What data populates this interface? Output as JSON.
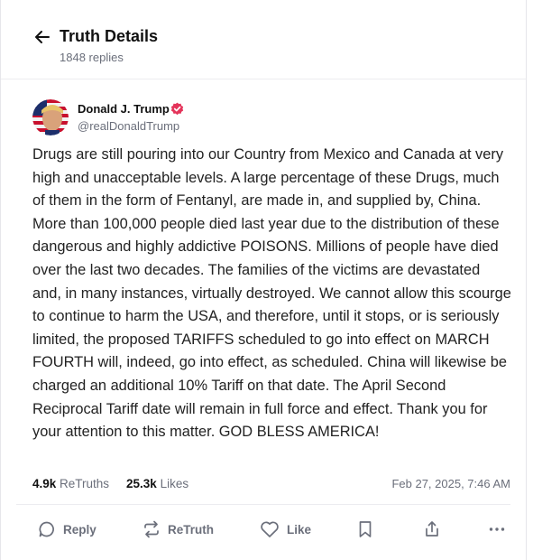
{
  "header": {
    "title": "Truth Details",
    "replies": "1848 replies"
  },
  "post": {
    "author_name": "Donald J. Trump",
    "handle": "@realDonaldTrump",
    "text": "Drugs are still pouring into our Country from Mexico and Canada at very high and unacceptable levels. A large percentage of these Drugs, much of them in the form of Fentanyl, are made in, and supplied by, China. More than 100,000 people died last year due to the distribution of these dangerous and highly addictive POISONS. Millions of people have died over the last two decades. The families of the victims are devastated and, in many instances, virtually destroyed. We cannot allow this scourge to continue to harm the USA, and therefore, until it stops, or is seriously limited, the proposed TARIFFS scheduled to go into effect on MARCH FOURTH will, indeed, go into effect, as scheduled. China will likewise be charged an additional 10% Tariff on that date. The April Second Reciprocal Tariff date will remain in full force and effect. Thank you for your attention to this matter. GOD BLESS AMERICA!",
    "retruths_count": "4.9k",
    "retruths_label": "ReTruths",
    "likes_count": "25.3k",
    "likes_label": "Likes",
    "date": "Feb 27, 2025, 7:46 AM"
  },
  "actions": {
    "reply": "Reply",
    "retruth": "ReTruth",
    "like": "Like"
  },
  "icons": {
    "back": "arrow-left-icon",
    "verified": "verified-badge-icon",
    "reply": "speech-bubble-icon",
    "retruth": "repost-arrows-icon",
    "like": "heart-icon",
    "bookmark": "bookmark-icon",
    "share": "share-upload-icon",
    "more": "ellipsis-icon"
  },
  "colors": {
    "verified": "#e4345a",
    "muted": "#6b6f7b",
    "text": "#222222"
  }
}
